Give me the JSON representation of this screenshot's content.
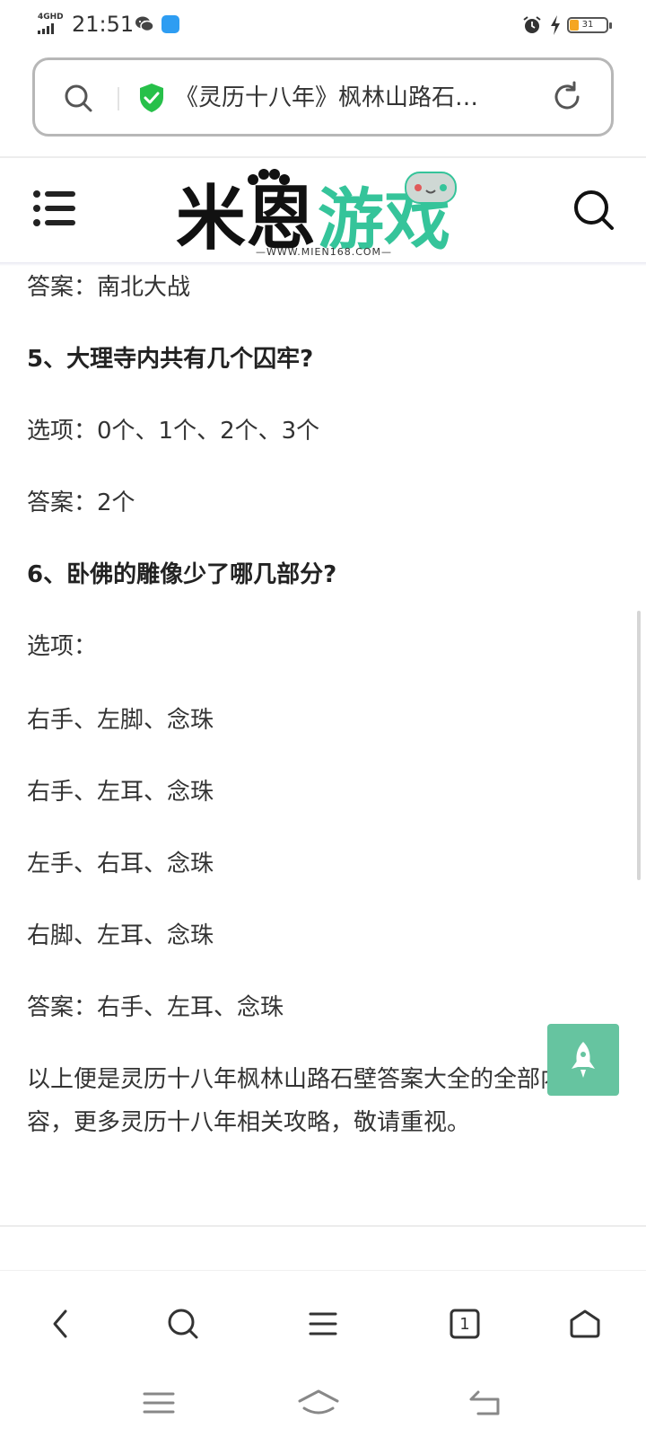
{
  "status_bar": {
    "network": "4GHD",
    "time": "21:51",
    "battery": "31"
  },
  "url_bar": {
    "title": "《灵历十八年》枫林山路石…"
  },
  "site": {
    "logo_text": "米恩游戏",
    "logo_url": "—WWW.MIEN168.COM—"
  },
  "article": {
    "lines": [
      "答案：南北大战",
      "5、大理寺内共有几个囚牢?",
      "选项：0个、1个、2个、3个",
      "答案：2个",
      "6、卧佛的雕像少了哪几部分?",
      "选项：",
      "右手、左脚、念珠",
      "右手、左耳、念珠",
      "左手、右耳、念珠",
      "右脚、左耳、念珠",
      "答案：右手、左耳、念珠",
      "以上便是灵历十八年枫林山路石壁答案大全的全部内容，更多灵历十八年相关攻略，敬请重视。"
    ]
  },
  "toolbar": {
    "tab_count": "1"
  },
  "colors": {
    "accent_green": "#66c4a0",
    "shield_green": "#27c04a",
    "text": "#333333"
  },
  "icons": [
    "search-icon",
    "shield-icon",
    "reload-icon",
    "menu-icon",
    "rocket-icon",
    "back-icon",
    "tabs-icon",
    "home-icon"
  ]
}
